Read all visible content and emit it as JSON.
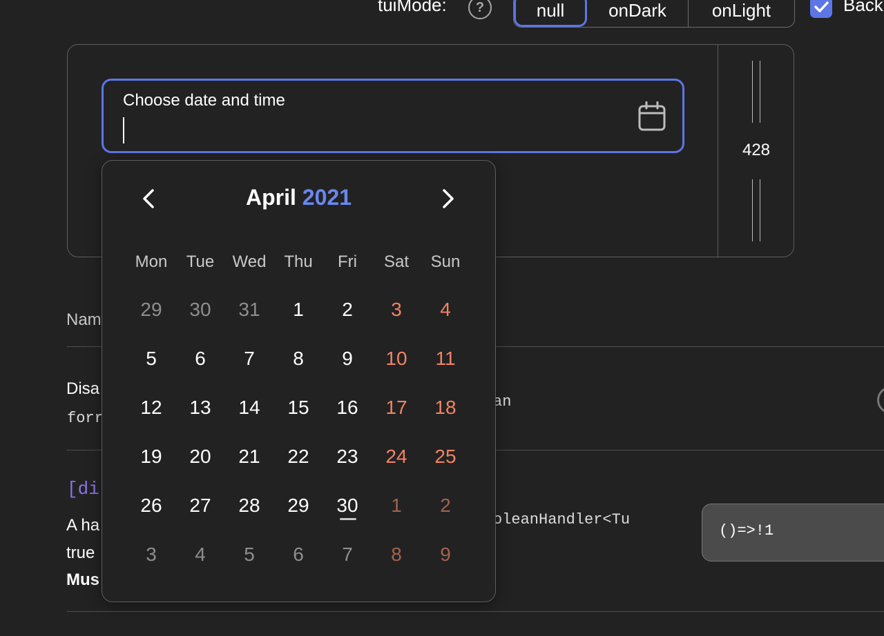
{
  "toolbar": {
    "mode_label": "tuiMode:",
    "mode_options": [
      {
        "label": "null",
        "active": true
      },
      {
        "label": "onDark",
        "active": false
      },
      {
        "label": "onLight",
        "active": false
      }
    ],
    "checkbox_label": "Back",
    "checkbox_checked": true
  },
  "demo": {
    "input_label": "Choose date and time",
    "width_value": "428"
  },
  "calendar": {
    "month": "April",
    "year": "2021",
    "weekdays": [
      "Mon",
      "Tue",
      "Wed",
      "Thu",
      "Fri",
      "Sat",
      "Sun"
    ],
    "weeks": [
      [
        "29",
        "30",
        "31",
        "1",
        "2",
        "3",
        "4"
      ],
      [
        "5",
        "6",
        "7",
        "8",
        "9",
        "10",
        "11"
      ],
      [
        "12",
        "13",
        "14",
        "15",
        "16",
        "17",
        "18"
      ],
      [
        "19",
        "20",
        "21",
        "22",
        "23",
        "24",
        "25"
      ],
      [
        "26",
        "27",
        "28",
        "29",
        "30",
        "1",
        "2"
      ],
      [
        "3",
        "4",
        "5",
        "6",
        "7",
        "8",
        "9"
      ]
    ],
    "today": "30"
  },
  "docs": {
    "header_name": "Nam",
    "row1_text": "Disa",
    "row1_mono": "forr",
    "row1_type": "an",
    "row2_attr": "[di",
    "row2_line1": "A ha",
    "row2_line2": "true",
    "row2_line3": "Mus",
    "row2_type": "oleanHandler<Tu",
    "row2_code": "()=>!1"
  },
  "colors": {
    "accent": "#5c76e6",
    "year": "#6a87f0",
    "weekend": "#f28364",
    "background": "#222222"
  }
}
